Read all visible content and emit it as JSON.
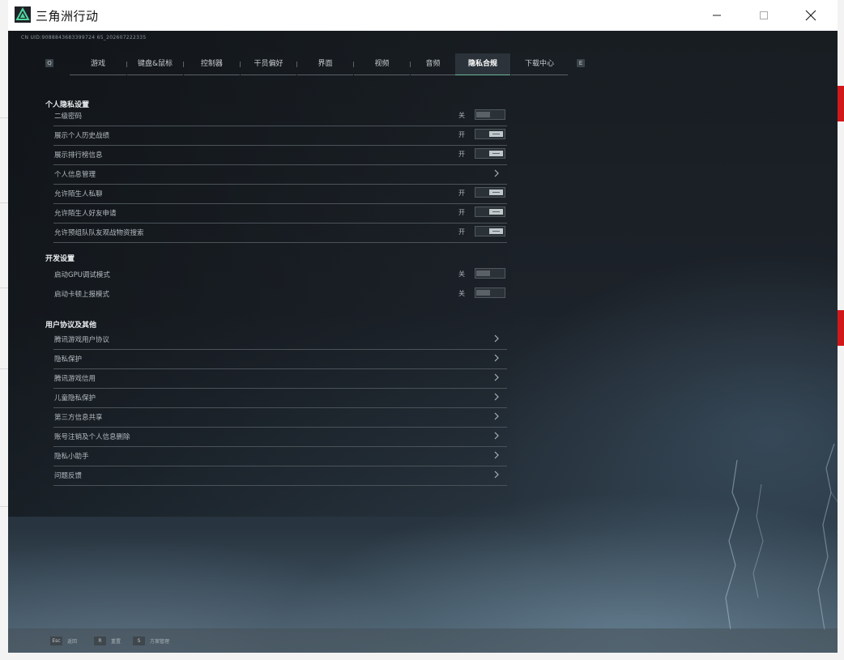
{
  "window": {
    "title": "三角洲行动",
    "controls": {
      "minimize": "minimize-icon",
      "maximize": "maximize-icon",
      "close": "close-icon"
    }
  },
  "game": {
    "uid": "CN UID:9088843683399724 65_202607222335"
  },
  "tabs": {
    "prev_key": "Q",
    "next_key": "E",
    "items": [
      {
        "label": "游戏"
      },
      {
        "label": "键盘&鼠标"
      },
      {
        "label": "控制器"
      },
      {
        "label": "干员偏好"
      },
      {
        "label": "界面"
      },
      {
        "label": "视频"
      },
      {
        "label": "音频"
      },
      {
        "label": "隐私合规",
        "active": true
      },
      {
        "label": "下载中心"
      }
    ]
  },
  "privacy": {
    "title": "个人隐私设置",
    "rows": [
      {
        "label": "二级密码",
        "type": "toggle",
        "state": "关",
        "on": false
      },
      {
        "label": "展示个人历史战绩",
        "type": "toggle",
        "state": "开",
        "on": true
      },
      {
        "label": "展示排行榜信息",
        "type": "toggle",
        "state": "开",
        "on": true
      },
      {
        "label": "个人信息管理",
        "type": "link"
      },
      {
        "label": "允许陌生人私聊",
        "type": "toggle",
        "state": "开",
        "on": true
      },
      {
        "label": "允许陌生人好友申请",
        "type": "toggle",
        "state": "开",
        "on": true
      },
      {
        "label": "允许预组队队友观战物资搜索",
        "type": "toggle",
        "state": "开",
        "on": true
      }
    ]
  },
  "developer": {
    "title": "开发设置",
    "rows": [
      {
        "label": "启动GPU调试模式",
        "type": "toggle",
        "state": "关",
        "on": false
      },
      {
        "label": "启动卡顿上报模式",
        "type": "toggle",
        "state": "关",
        "on": false
      }
    ]
  },
  "agreements": {
    "title": "用户协议及其他",
    "rows": [
      {
        "label": "腾讯游戏用户协议",
        "type": "link"
      },
      {
        "label": "隐私保护",
        "type": "link"
      },
      {
        "label": "腾讯游戏信用",
        "type": "link"
      },
      {
        "label": "儿童隐私保护",
        "type": "link"
      },
      {
        "label": "第三方信息共享",
        "type": "link"
      },
      {
        "label": "账号注销及个人信息删除",
        "type": "link"
      },
      {
        "label": "隐私小助手",
        "type": "link"
      },
      {
        "label": "问题反馈",
        "type": "link"
      }
    ]
  },
  "bottom_hints": [
    {
      "key": "Esc",
      "label": "返回"
    },
    {
      "key": "R",
      "label": "重置"
    },
    {
      "key": "S",
      "label": "方案管理"
    }
  ],
  "colors": {
    "accent": "#6ab89a",
    "background": "#1c2229"
  }
}
